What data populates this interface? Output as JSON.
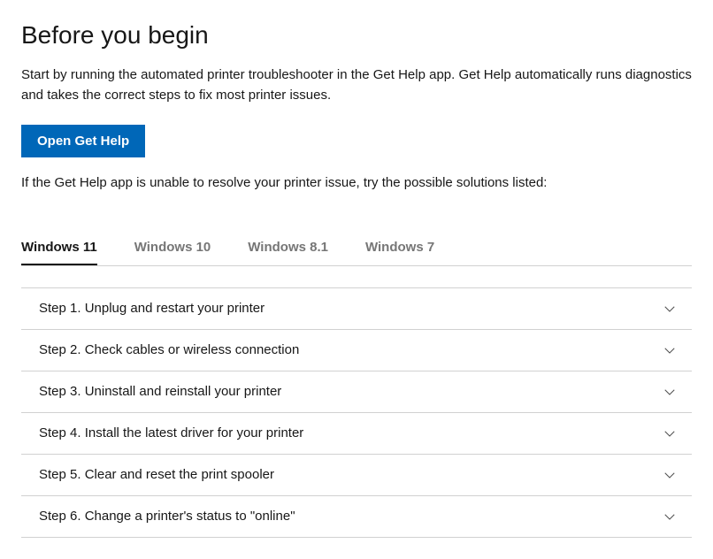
{
  "header": {
    "title": "Before you begin"
  },
  "intro": {
    "text": "Start by running the automated printer troubleshooter in the Get Help app. Get Help automatically runs diagnostics and takes the correct steps to fix most printer issues."
  },
  "button": {
    "label": "Open Get Help"
  },
  "followup": {
    "text": "If the Get Help app is unable to resolve your printer issue, try the possible solutions listed:"
  },
  "tabs": [
    {
      "label": "Windows 11",
      "active": true
    },
    {
      "label": "Windows 10",
      "active": false
    },
    {
      "label": "Windows 8.1",
      "active": false
    },
    {
      "label": "Windows 7",
      "active": false
    }
  ],
  "steps": [
    {
      "label": "Step 1. Unplug and restart your printer"
    },
    {
      "label": "Step 2. Check cables or wireless connection"
    },
    {
      "label": "Step 3. Uninstall and reinstall your printer"
    },
    {
      "label": "Step 4. Install the latest driver for your printer"
    },
    {
      "label": "Step 5. Clear and reset the print spooler"
    },
    {
      "label": "Step 6. Change a printer's status to \"online\""
    }
  ]
}
